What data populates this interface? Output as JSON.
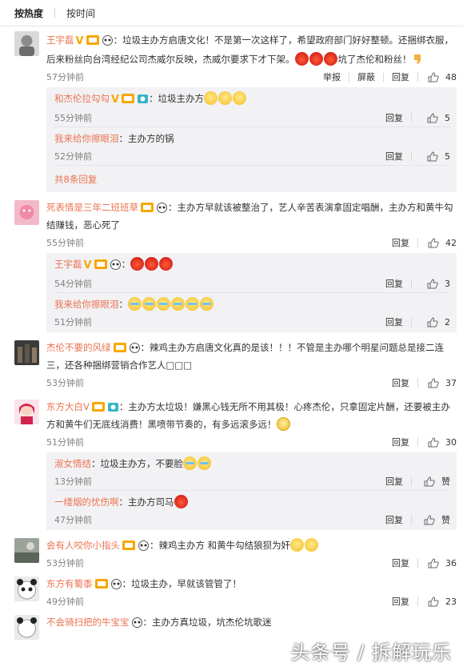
{
  "tabs": {
    "hot": "按热度",
    "time": "按时间"
  },
  "actions": {
    "report": "举报",
    "block": "屏蔽",
    "reply": "回复",
    "like_word": "赞"
  },
  "comments": [
    {
      "user": "王宇磊",
      "text": "：垃圾主办方启唐文化！不是第一次这样了，希望政府部门好好整顿。还捆绑衣服，后来粉丝向台湾经纪公司杰威尔反映，杰威尔要求下才下架。",
      "text_end": "坑了杰伦和粉丝！",
      "time": "57分钟前",
      "likes": "48",
      "replies": [
        {
          "user": "和杰伦拉勾勾",
          "text": "：垃圾主办方",
          "time": "55分钟前",
          "likes": "5"
        },
        {
          "user": "我来给你擦眼泪",
          "text": "：主办方的锅",
          "time": "52分钟前",
          "likes": "5"
        }
      ],
      "more": "共8条回复"
    },
    {
      "user": "死表情是三年二班班草",
      "text": "：主办方早就该被整治了，艺人辛苦表演拿固定唱酬，主办方和黄牛勾结赚钱，恶心死了",
      "time": "55分钟前",
      "likes": "42",
      "replies": [
        {
          "user": "王宇磊",
          "text": "：",
          "time": "54分钟前",
          "likes": "3"
        },
        {
          "user": "我来给你擦眼泪",
          "text": "：",
          "time": "51分钟前",
          "likes": "2"
        }
      ]
    },
    {
      "user": "杰伦不要的风绿",
      "text": "：辣鸡主办方启唐文化真的是该！！！不管是主办哪个明星问题总是接二连三，还各种捆绑营销合作艺人□□□",
      "time": "53分钟前",
      "likes": "37"
    },
    {
      "user": "东方大白V",
      "text": "：主办方太垃圾！嫌黑心钱无所不用其极！心疼杰伦，只拿固定片酬，还要被主办方和黄牛们无底线消费！黑喷带节奏的，有多远滚多远！",
      "time": "51分钟前",
      "likes": "30",
      "replies": [
        {
          "user": "淑女情结",
          "text": "：垃圾主办方，不要脸",
          "time": "13分钟前",
          "likes": "赞"
        },
        {
          "user": "一缕烟的忧伤啊",
          "text": "：主办方司马",
          "time": "47分钟前",
          "likes": "赞"
        }
      ]
    },
    {
      "user": "会有人咬你小指头",
      "text": "：辣鸡主办方 和黄牛勾结狼狈为奸",
      "time": "53分钟前",
      "likes": "36"
    },
    {
      "user": "东方有蜀黍",
      "text": "：垃圾主办，早就该管管了！",
      "time": "49分钟前",
      "likes": "23"
    },
    {
      "user": "不会骑扫把的牛宝宝",
      "text": "：主办方真垃圾，坑杰伦坑歌迷"
    }
  ],
  "watermark": "头条号 / 拆解玩乐",
  "colors": {
    "username": "#eb7350",
    "subbg": "#f2f2f5"
  }
}
